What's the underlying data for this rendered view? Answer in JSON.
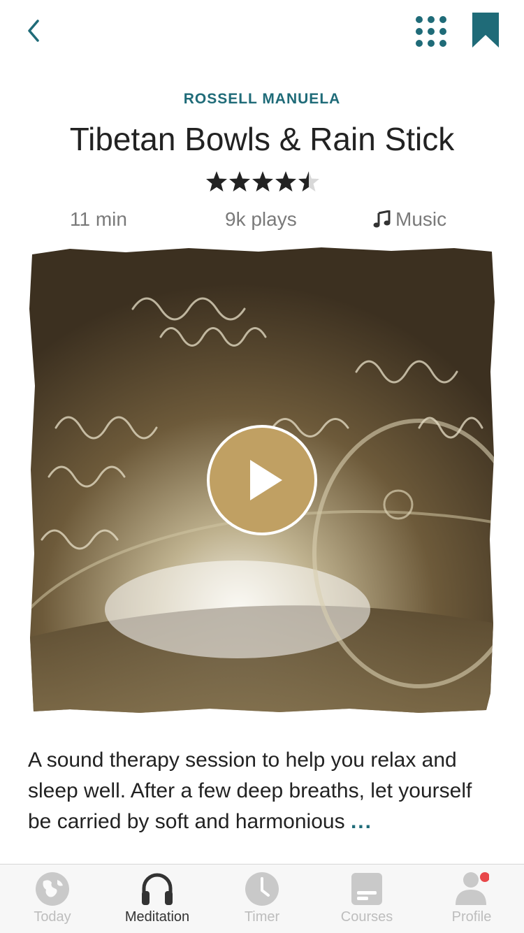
{
  "header": {
    "author": "ROSSELL MANUELA",
    "title": "Tibetan Bowls & Rain Stick",
    "rating": 4.5
  },
  "meta": {
    "duration": "11 min",
    "plays": "9k plays",
    "category": "Music"
  },
  "description": {
    "text": "A sound therapy session to help you relax and sleep well. After a few deep breaths, let yourself be carried by soft and harmonious",
    "more": "..."
  },
  "tabs": [
    {
      "label": "Today",
      "icon": "globe-icon",
      "active": false
    },
    {
      "label": "Meditation",
      "icon": "headphones-icon",
      "active": true
    },
    {
      "label": "Timer",
      "icon": "clock-icon",
      "active": false
    },
    {
      "label": "Courses",
      "icon": "courses-icon",
      "active": false
    },
    {
      "label": "Profile",
      "icon": "profile-icon",
      "active": false
    }
  ],
  "colors": {
    "accent": "#1f6b78",
    "play_button": "#c0a063",
    "notification_dot": "#e8474a"
  }
}
